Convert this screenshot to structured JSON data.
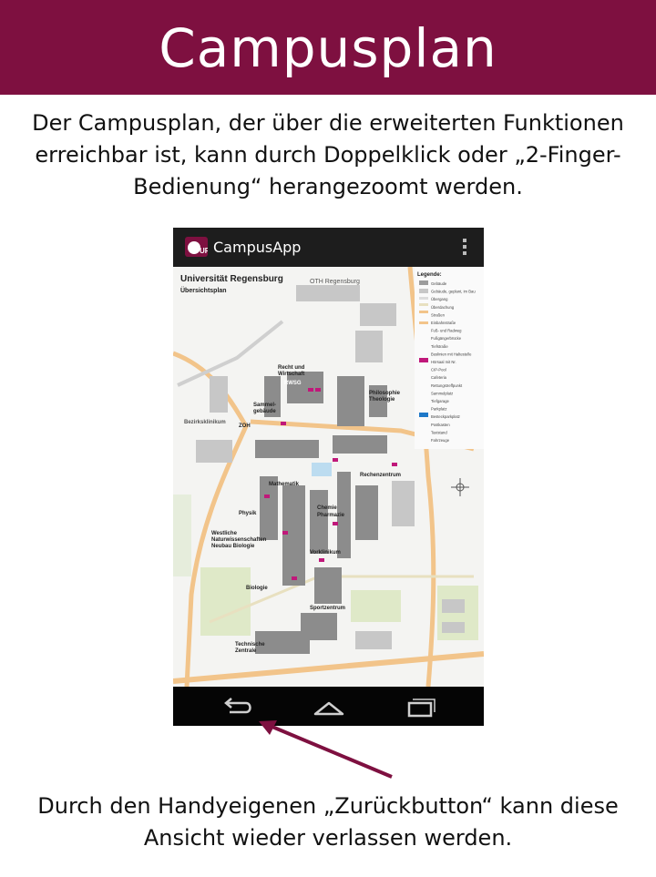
{
  "slide": {
    "title": "Campusplan",
    "intro_line1": "Der Campusplan, der über die erweiterten Funktionen",
    "intro_line2": "erreichbar ist, kann durch Doppelklick oder „2-Finger-",
    "intro_line3": "Bedienung“ herangezoomt werden.",
    "outro_line1": "Durch den Handyeigenen „Zurückbutton“ kann diese",
    "outro_line2": "Ansicht wieder verlassen werden."
  },
  "app": {
    "title": "CampusApp",
    "logo_text": "UR",
    "overflow_icon": "overflow-menu-icon"
  },
  "map": {
    "title": "Universität Regensburg",
    "subtitle": "Übersichtsplan",
    "oth": "OTH Regensburg",
    "legend_title": "Legende:",
    "labels": {
      "recht": "Recht und",
      "wirtschaft": "Wirtschaft",
      "rwsg": "RWSG",
      "sammel": "Sammel-",
      "gebaeude": "gebäude",
      "philosophie": "Philosophie",
      "theologie": "Theologie",
      "zoh": "ZOH",
      "bezirks": "Bezirksklinikum",
      "rechenzentrum": "Rechenzentrum",
      "mathematik": "Mathematik",
      "physik": "Physik",
      "chemie": "Chemie",
      "pharmazie": "Pharmazie",
      "westliche": "Westliche",
      "naturwiss": "Naturwissenschaften",
      "neubau": "Neubau Biologie",
      "vorklinikum": "Vorklinikum",
      "biologie": "Biologie",
      "sportzentrum": "Sportzentrum",
      "technische": "Technische",
      "zentrale": "Zentrale"
    },
    "legend_items": [
      "Gebäude",
      "Gebäude, geplant, im Bau",
      "Übergang",
      "Überdachung",
      "Straßen",
      "Einbahnstraße",
      "Fuß- und Radweg",
      "Fußgängerbrücke",
      "Tiefstraße",
      "Buslinien mit Haltestelle",
      "Hörsaal mit Nr.",
      "CIP-Pool",
      "Cafeteria",
      "Rettungstreffpunkt",
      "Sammelplatz",
      "Tiefgarage",
      "Parkplatz",
      "Besteckparkplatz",
      "Postkasten",
      "Taxistand",
      "Fahrzeuge"
    ]
  },
  "nav": {
    "back_icon": "back-arrow-icon",
    "home_icon": "home-icon",
    "recents_icon": "recent-apps-icon"
  },
  "colors": {
    "banner": "#7e1040",
    "arrow": "#7e1040",
    "road": "#f2c48a",
    "hall": "#c0187a"
  }
}
